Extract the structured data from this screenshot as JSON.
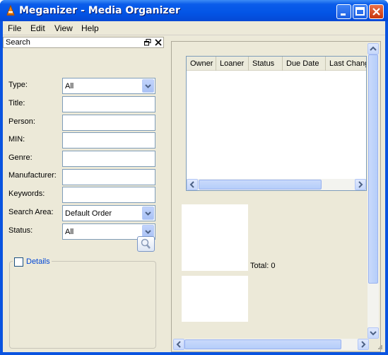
{
  "window": {
    "title": "Meganizer - Media Organizer"
  },
  "menu": [
    {
      "label": "File"
    },
    {
      "label": "Edit"
    },
    {
      "label": "View"
    },
    {
      "label": "Help"
    }
  ],
  "search_panel": {
    "title": "Search",
    "fields": {
      "type": {
        "label": "Type:",
        "value": "All"
      },
      "title": {
        "label": "Title:",
        "value": ""
      },
      "person": {
        "label": "Person:",
        "value": ""
      },
      "min": {
        "label": "MIN:",
        "value": ""
      },
      "genre": {
        "label": "Genre:",
        "value": ""
      },
      "manufacturer": {
        "label": "Manufacturer:",
        "value": ""
      },
      "keywords": {
        "label": "Keywords:",
        "value": ""
      },
      "search_area": {
        "label": "Search Area:",
        "value": "Default Order"
      },
      "status": {
        "label": "Status:",
        "value": "All"
      }
    },
    "details_label": "Details",
    "details_checked": false
  },
  "loans_table": {
    "columns": [
      "Owner",
      "Loaner",
      "Status",
      "Due Date",
      "Last Change"
    ]
  },
  "total_label": "Total: 0"
}
